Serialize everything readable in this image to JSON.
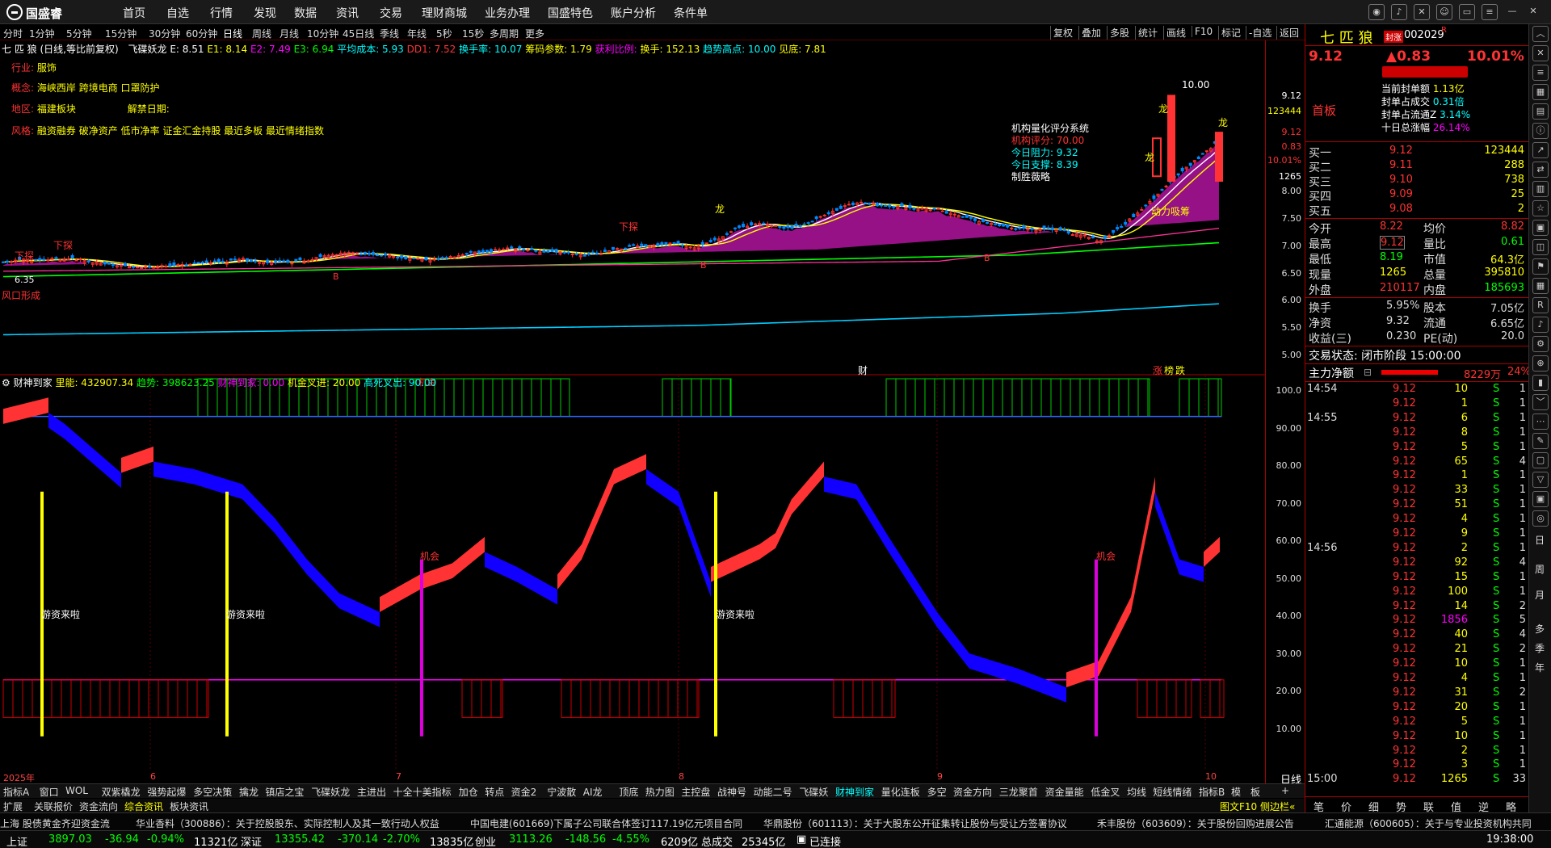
{
  "menubar": {
    "logo": "国盛睿",
    "items": [
      "首页",
      "自选",
      "行情",
      "发现",
      "数据",
      "资讯",
      "交易",
      "理财商城",
      "业务办理",
      "国盛特色",
      "账户分析",
      "条件单"
    ]
  },
  "periods": [
    "分时",
    "1分钟",
    "5分钟",
    "15分钟",
    "30分钟",
    "60分钟",
    "日线",
    "周线",
    "月线",
    "10分钟",
    "45日线",
    "季线",
    "年线",
    "5秒",
    "15秒",
    "多周期",
    "更多"
  ],
  "chart_toolbar": [
    "复权",
    "叠加",
    "多股",
    "统计",
    "画线",
    "F10",
    "标记",
    "-自选",
    "返回"
  ],
  "info_line": {
    "stock": "七 匹 狼",
    "mode": "(日线,等比前复权)",
    "indicator": "飞碟妖龙",
    "e": "E: 8.51",
    "e1": "E1: 8.14",
    "e2": "E2: 7.49",
    "e3": "E3: 6.94",
    "avg_cost": "平均成本: 5.93",
    "dd1": "DD1: 7.52",
    "turnover_rate": "换手率: 10.07",
    "chip_param": "筹码参数: 1.79",
    "profit_ratio": "获利比例:",
    "turnover": "换手: 152.13",
    "trend_high": "趋势高点: 10.00",
    "see_bottom": "见底: 7.81"
  },
  "info_rows": {
    "industry_label": "行业:",
    "industry": "服饰",
    "concept_label": "概念:",
    "concept": "海峡西岸 跨境电商 口罩防护",
    "region_label": "地区:",
    "region": "福建板块",
    "unlock_label": "解禁日期:",
    "style_label": "风格:",
    "style": "融资融券 破净资产 低市净率 证金汇金持股 最近多板 最近情绪指数"
  },
  "quant_box": {
    "title": "机构量化评分系统",
    "score": "机构评分: 70.00",
    "resistance": "今日阻力: 9.32",
    "support": "今日支撑: 8.39",
    "result": "制胜薇略"
  },
  "main_annotations": {
    "top_price": "10.00",
    "low_price": "6.35",
    "dragon": "龙",
    "lows": "下探",
    "wind": "风口形成",
    "power": "动力吸筹",
    "cai": "财",
    "zhang": "涨",
    "bang": "榜",
    "die": "跌",
    "b": "B",
    "s": "S",
    "chance": "机会",
    "cash": "游资来啦"
  },
  "ylabels_main": [
    "9.12",
    "123444",
    "9.12",
    "0.83",
    "10.01%",
    "1265",
    "8.00",
    "7.50",
    "7.00",
    "6.50",
    "6.00",
    "5.50",
    "5.00"
  ],
  "ylabels_ind": [
    "100.0",
    "90.00",
    "80.00",
    "70.00",
    "60.00",
    "50.00",
    "40.00",
    "30.00",
    "20.00",
    "10.00"
  ],
  "indicator_legend": {
    "name": "财神到家",
    "a": "里能: 432907.34",
    "b": "趋势: 398623.25",
    "c": "财神到家: 0.00",
    "d": "机金叉进: 20.00",
    "e": "高死叉出: 90.00"
  },
  "xlabels": [
    "2025年",
    "6",
    "7",
    "8",
    "9",
    "10"
  ],
  "xaxis_right": "日线",
  "tabs1": [
    "指标A",
    "窗口",
    "WOL",
    "双紫橇龙",
    "强势起爆",
    "多空决策",
    "擒龙",
    "镇店之宝",
    "飞碟妖龙",
    "主进出",
    "十全十美指标",
    "加仓",
    "转点",
    "资金2",
    "宁波散",
    "AI龙",
    "顶底",
    "热力图",
    "主控盘",
    "战神号",
    "动能二号",
    "飞碟妖",
    "财神到家",
    "量化连板",
    "多空",
    "资金方向",
    "三龙聚首",
    "资金量能",
    "低金叉",
    "均线",
    "短线情绪"
  ],
  "tabs1_right": [
    "指标B",
    "模",
    "板",
    "+"
  ],
  "tabs2": [
    "扩展",
    "关联报价",
    "资金流向",
    "综合资讯",
    "板块资讯"
  ],
  "tabs2_right": "图文F10 侧边栏«",
  "ticker": [
    "上海  股债黄金齐迎资金流",
    "华业香料（300886）：关于控股股东、实际控制人及其一致行动人权益",
    "中国电建(601669)下属子公司联合体签订117.19亿元项目合同",
    "华鼎股份（601113）：关于大股东公开征集转让股份与受让方签署协议",
    "禾丰股份（603609）：关于股份回购进展公告",
    "汇通能源（600605）：关于与专业投资机构共同"
  ],
  "statusbar": {
    "sh_label": "上证",
    "sh_val": "3897.03",
    "sh_chg": "-36.94",
    "sh_pct": "-0.94%",
    "sh_amt": "11321亿",
    "sz_label": "深证",
    "sz_val": "13355.42",
    "sz_chg": "-370.14",
    "sz_pct": "-2.70%",
    "sz_amt": "13835亿",
    "cy_label": "创业",
    "cy_val": "3113.26",
    "cy_chg": "-148.56",
    "cy_pct": "-4.55%",
    "cy_amt": "6209亿",
    "total_label": "总成交",
    "total": "25345亿",
    "conn": "已连接",
    "time": "19:38:00"
  },
  "right": {
    "name": "七 匹 狼",
    "tag": "封涨",
    "code": "002029",
    "r": "R",
    "price": "9.12",
    "change": "▲0.83",
    "pct": "10.01%",
    "first_board": "首板",
    "seal": [
      {
        "label": "当前封单额",
        "value": "1.13亿"
      },
      {
        "label": "封单占成交",
        "value": "0.31倍"
      },
      {
        "label": "封单占流通Z",
        "value": "3.14%"
      },
      {
        "label": "十日总涨幅",
        "value": "26.14%"
      }
    ],
    "book": [
      {
        "label": "买一",
        "price": "9.12",
        "vol": "123444"
      },
      {
        "label": "买二",
        "price": "9.11",
        "vol": "288"
      },
      {
        "label": "买三",
        "price": "9.10",
        "vol": "738"
      },
      {
        "label": "买四",
        "price": "9.09",
        "vol": "25"
      },
      {
        "label": "买五",
        "price": "9.08",
        "vol": "2"
      }
    ],
    "stats": [
      {
        "l1": "今开",
        "v1": "8.22",
        "l2": "均价",
        "v2": "8.82"
      },
      {
        "l1": "最高",
        "v1": "9.12",
        "l2": "量比",
        "v2": "0.61"
      },
      {
        "l1": "最低",
        "v1": "8.19",
        "l2": "市值",
        "v2": "64.3亿"
      },
      {
        "l1": "现量",
        "v1": "1265",
        "l2": "总量",
        "v2": "395810"
      },
      {
        "l1": "外盘",
        "v1": "210117",
        "l2": "内盘",
        "v2": "185693"
      }
    ],
    "stats2": [
      {
        "l1": "换手",
        "v1": "5.95%",
        "l2": "股本",
        "v2": "7.05亿"
      },
      {
        "l1": "净资",
        "v1": "9.32",
        "l2": "流通",
        "v2": "6.65亿"
      },
      {
        "l1": "收益(三)",
        "v1": "0.230",
        "l2": "PE(动)",
        "v2": "20.0"
      }
    ],
    "trade_state": "交易状态: 闭市阶段 15:00:00",
    "main_flow_label": "主力净额",
    "main_flow_val": "8229万",
    "main_flow_pct": "24%",
    "ticks": [
      {
        "t": "14:54",
        "p": "9.12",
        "v": "10",
        "s": "S",
        "n": "1"
      },
      {
        "t": "",
        "p": "9.12",
        "v": "1",
        "s": "S",
        "n": "1"
      },
      {
        "t": "14:55",
        "p": "9.12",
        "v": "6",
        "s": "S",
        "n": "1"
      },
      {
        "t": "",
        "p": "9.12",
        "v": "8",
        "s": "S",
        "n": "1"
      },
      {
        "t": "",
        "p": "9.12",
        "v": "5",
        "s": "S",
        "n": "1"
      },
      {
        "t": "",
        "p": "9.12",
        "v": "65",
        "s": "S",
        "n": "4"
      },
      {
        "t": "",
        "p": "9.12",
        "v": "1",
        "s": "S",
        "n": "1"
      },
      {
        "t": "",
        "p": "9.12",
        "v": "33",
        "s": "S",
        "n": "1"
      },
      {
        "t": "",
        "p": "9.12",
        "v": "51",
        "s": "S",
        "n": "1"
      },
      {
        "t": "",
        "p": "9.12",
        "v": "4",
        "s": "S",
        "n": "1"
      },
      {
        "t": "",
        "p": "9.12",
        "v": "9",
        "s": "S",
        "n": "1"
      },
      {
        "t": "14:56",
        "p": "9.12",
        "v": "2",
        "s": "S",
        "n": "1"
      },
      {
        "t": "",
        "p": "9.12",
        "v": "92",
        "s": "S",
        "n": "4"
      },
      {
        "t": "",
        "p": "9.12",
        "v": "15",
        "s": "S",
        "n": "1"
      },
      {
        "t": "",
        "p": "9.12",
        "v": "100",
        "s": "S",
        "n": "1"
      },
      {
        "t": "",
        "p": "9.12",
        "v": "14",
        "s": "S",
        "n": "2"
      },
      {
        "t": "",
        "p": "9.12",
        "v": "1856",
        "s": "S",
        "n": "5"
      },
      {
        "t": "",
        "p": "9.12",
        "v": "40",
        "s": "S",
        "n": "4"
      },
      {
        "t": "",
        "p": "9.12",
        "v": "21",
        "s": "S",
        "n": "2"
      },
      {
        "t": "",
        "p": "9.12",
        "v": "10",
        "s": "S",
        "n": "1"
      },
      {
        "t": "",
        "p": "9.12",
        "v": "4",
        "s": "S",
        "n": "1"
      },
      {
        "t": "",
        "p": "9.12",
        "v": "31",
        "s": "S",
        "n": "2"
      },
      {
        "t": "",
        "p": "9.12",
        "v": "20",
        "s": "S",
        "n": "1"
      },
      {
        "t": "",
        "p": "9.12",
        "v": "5",
        "s": "S",
        "n": "1"
      },
      {
        "t": "",
        "p": "9.12",
        "v": "10",
        "s": "S",
        "n": "1"
      },
      {
        "t": "",
        "p": "9.12",
        "v": "2",
        "s": "S",
        "n": "1"
      },
      {
        "t": "",
        "p": "9.12",
        "v": "3",
        "s": "S",
        "n": "1"
      },
      {
        "t": "15:00",
        "p": "9.12",
        "v": "1265",
        "s": "S",
        "n": "33"
      }
    ],
    "bottom_tabs": [
      "笔",
      "价",
      "细",
      "势",
      "联",
      "值",
      "逆",
      "略"
    ]
  },
  "rightbar_labels": [
    "日",
    "周",
    "月",
    "多",
    "季",
    "年"
  ]
}
